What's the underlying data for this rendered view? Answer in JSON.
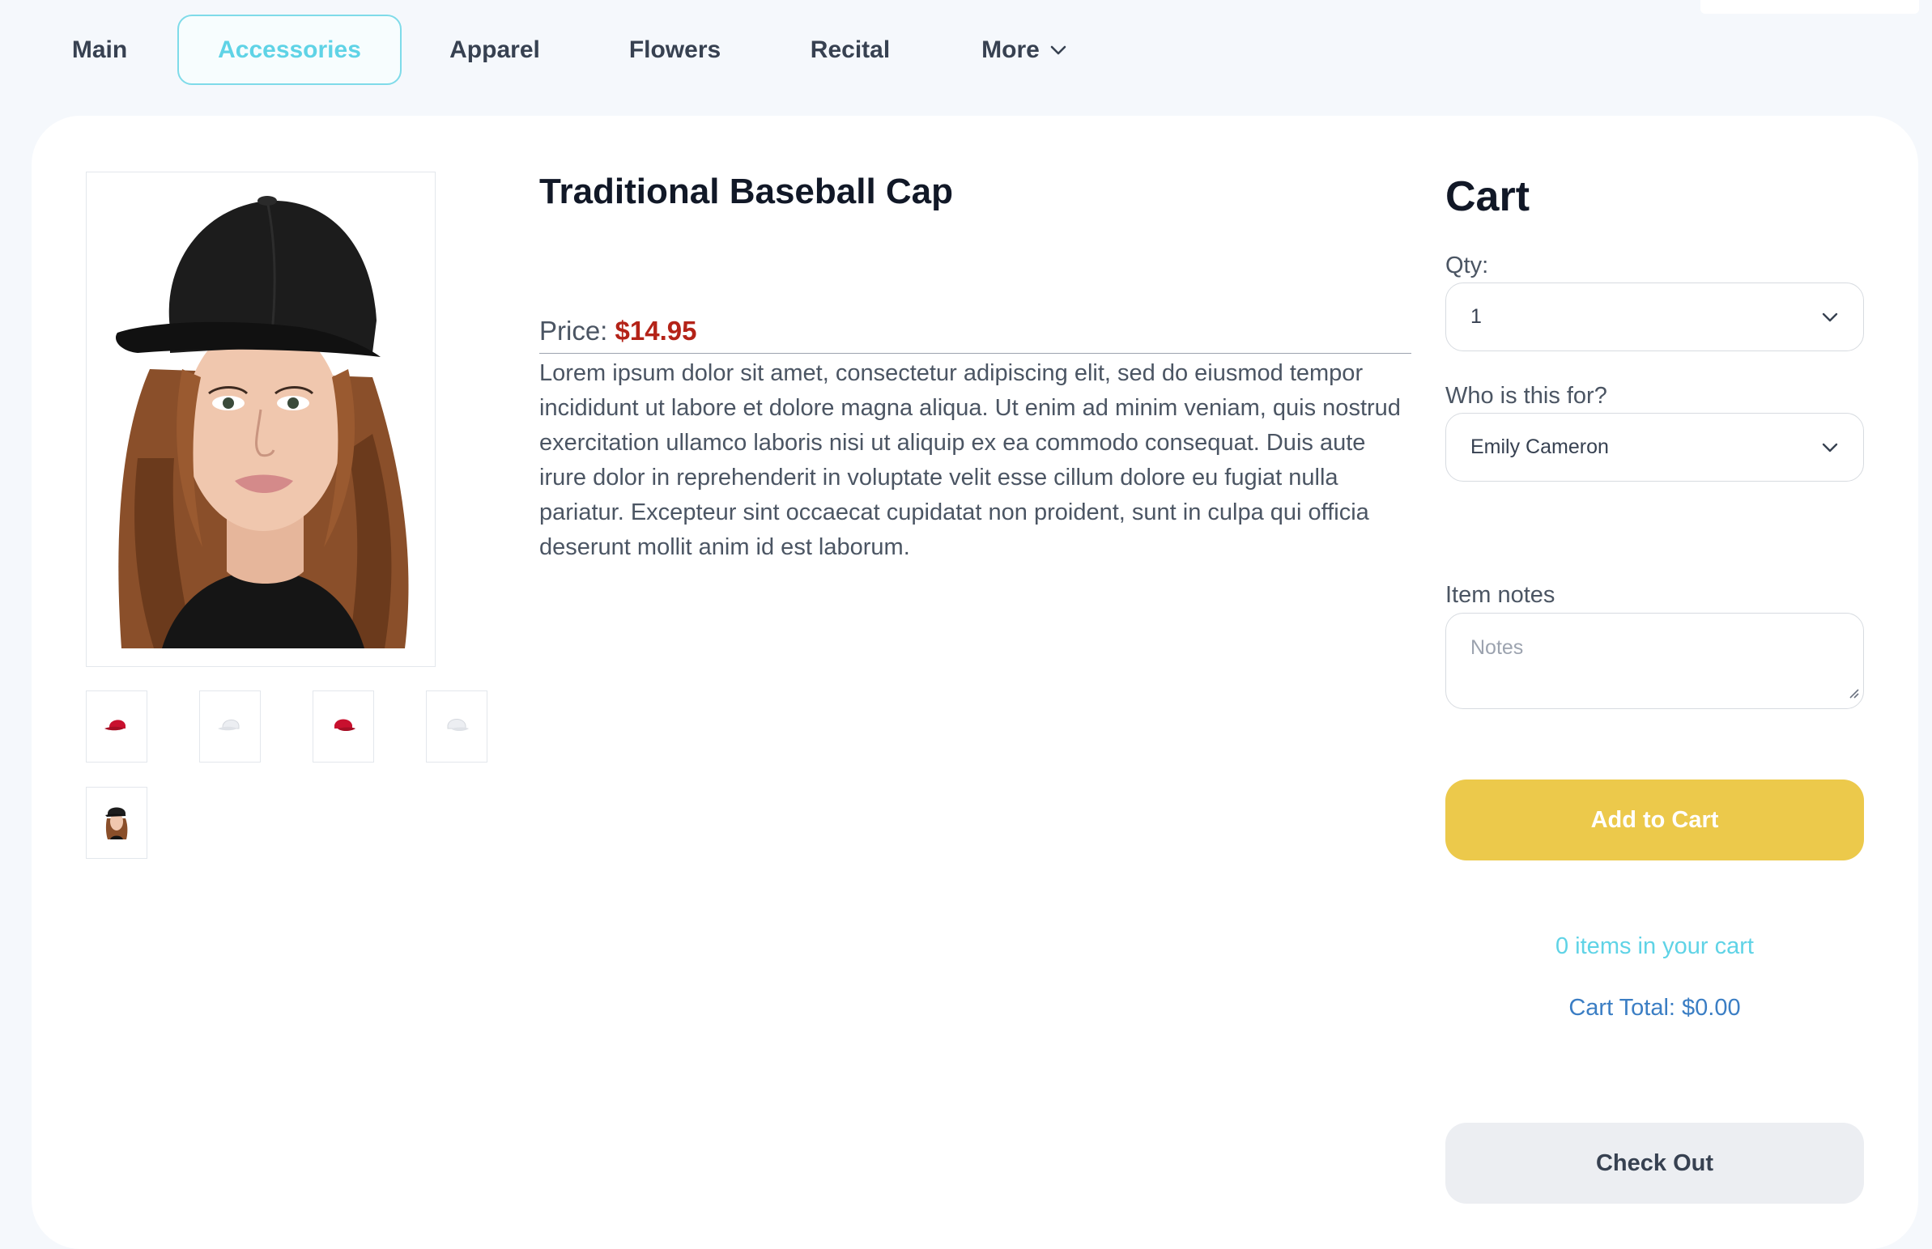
{
  "nav": {
    "items": [
      {
        "label": "Main"
      },
      {
        "label": "Accessories",
        "active": true
      },
      {
        "label": "Apparel"
      },
      {
        "label": "Flowers"
      },
      {
        "label": "Recital"
      },
      {
        "label": "More",
        "icon": "chevron-down-icon"
      }
    ]
  },
  "product": {
    "title": "Traditional Baseball Cap",
    "price_label": "Price:",
    "price_value": "$14.95",
    "description": "Lorem ipsum dolor sit amet, consectetur adipiscing elit, sed do eiusmod tempor incididunt ut labore et dolore magna aliqua. Ut enim ad minim veniam, quis nostrud exercitation ullamco laboris nisi ut aliquip ex ea commodo consequat. Duis aute irure dolor in reprehenderit in voluptate velit esse cillum dolore eu fugiat nulla pariatur. Excepteur sint occaecat cupidatat non proident, sunt in culpa qui officia deserunt mollit anim id est laborum.",
    "thumbnails": [
      "red-cap-icon",
      "white-cap-icon",
      "red-cap-icon",
      "white-cap-icon",
      "model-photo-icon"
    ]
  },
  "cart": {
    "title": "Cart",
    "qty_label": "Qty:",
    "qty_value": "1",
    "who_label": "Who is this for?",
    "who_value": "Emily Cameron",
    "notes_label": "Item notes",
    "notes_placeholder": "Notes",
    "add_button": "Add to Cart",
    "items_text": "0 items in your cart",
    "total_text": "Cart Total: $0.00",
    "checkout_button": "Check Out"
  },
  "colors": {
    "accent": "#5fd3e6",
    "add_button": "#ecc94b",
    "price": "#b42318",
    "total": "#3b7ec4",
    "page_bg": "#f5f8fc"
  }
}
